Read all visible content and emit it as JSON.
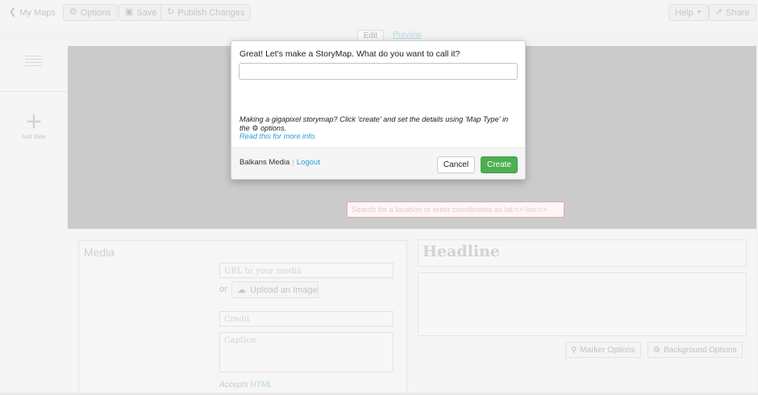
{
  "toolbar": {
    "my_maps": "My Maps",
    "options": "Options",
    "save": "Save",
    "publish": "Publish Changes",
    "help": "Help",
    "share": "Share"
  },
  "tabs": {
    "edit": "Edit",
    "preview": "Preview"
  },
  "sidebar": {
    "add_slide": "Add Slide"
  },
  "map": {
    "search_placeholder": "Search for a location or enter coordinates as lat:<> lon:<>"
  },
  "media": {
    "title": "Media",
    "url_placeholder": "URL to your media",
    "or": "or",
    "upload_label": "Upload an Image",
    "credit_placeholder": "Credit",
    "caption_placeholder": "Caption",
    "accepts_prefix": "Accepts",
    "accepts_link": "HTML"
  },
  "slide": {
    "headline_placeholder": "Headline",
    "marker_options": "Marker Options",
    "background_options": "Background Options"
  },
  "modal": {
    "question": "Great! Let's make a StoryMap. What do you want to call it?",
    "input_value": "",
    "hint_prefix": "Making a gigapixel storymap? Click 'create' and set the details using 'Map Type' in the",
    "hint_suffix": "options.",
    "info_link": "Read this for more info.",
    "account_name": "Balkans Media",
    "logout": "Logout",
    "cancel": "Cancel",
    "create": "Create"
  },
  "colors": {
    "create_button": "#4caf50",
    "link": "#2a9fd0",
    "map_overlay": "#cbcbcb"
  }
}
